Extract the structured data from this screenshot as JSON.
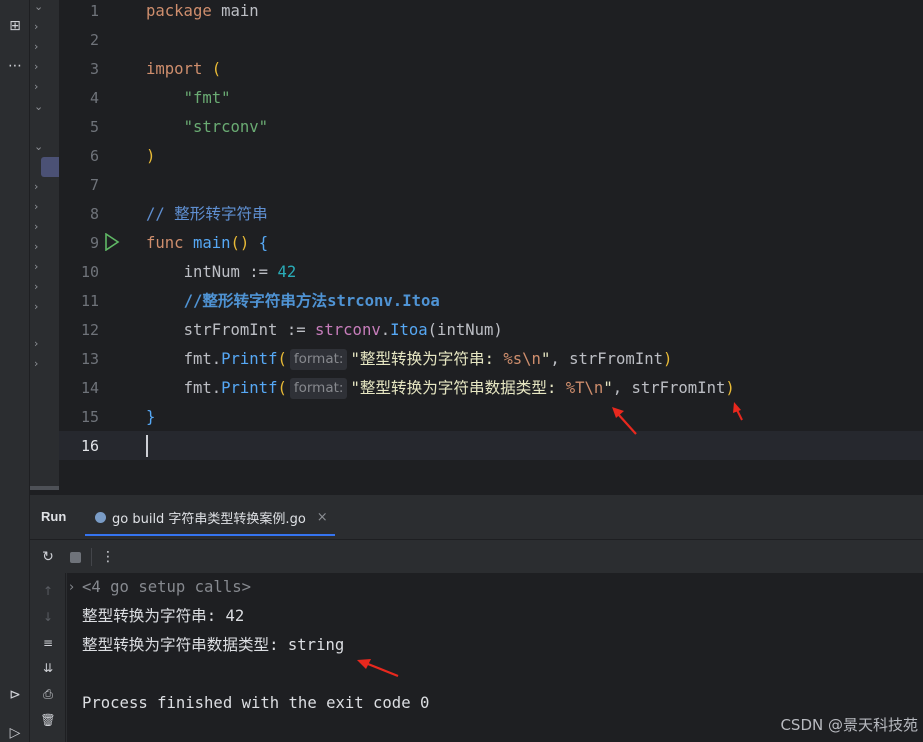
{
  "editor": {
    "line_numbers": [
      "1",
      "2",
      "3",
      "4",
      "5",
      "6",
      "7",
      "8",
      "9",
      "10",
      "11",
      "12",
      "13",
      "14",
      "15",
      "16"
    ],
    "current_line": "16",
    "code": {
      "l1_kw": "package",
      "l1_name": " main",
      "l3_kw": "import",
      "l3_paren": "(",
      "l4_str": "\"fmt\"",
      "l5_str": "\"strconv\"",
      "l6_paren": ")",
      "l8_cmt": "// 整形转字符串",
      "l9_kw": "func",
      "l9_fn": "main",
      "l9_parens": "()",
      "l9_brace": "{",
      "l10_ident": "intNum := ",
      "l10_num": "42",
      "l11_cmt": "//整形转字符串方法strconv.Itoa",
      "l12_ident": "strFromInt := ",
      "l12_pkg": "strconv",
      "l12_dot": ".",
      "l12_fn": "Itoa",
      "l12_args": "(intNum)",
      "l13_pkg": "fmt",
      "l13_dot": ".",
      "l13_fn": "Printf",
      "l13_open": "(",
      "l13_hint": "format:",
      "l13_str_a": "\"整型转换为字符串: ",
      "l13_esc": "%s\\n",
      "l13_str_b": "\"",
      "l13_rest": ", strFromInt",
      "l13_close": ")",
      "l14_pkg": "fmt",
      "l14_dot": ".",
      "l14_fn": "Printf",
      "l14_open": "(",
      "l14_hint": "format:",
      "l14_str_a": "\"整型转换为字符串数据类型: ",
      "l14_esc": "%T\\n",
      "l14_str_b": "\"",
      "l14_rest": ", strFromInt",
      "l14_close": ")",
      "l15_brace": "}"
    }
  },
  "run_panel": {
    "title": "Run",
    "tab_label": "go build 字符串类型转换案例.go",
    "tab_close": "×",
    "console_lines": {
      "setup": "<4 go setup calls>",
      "out1": "整型转换为字符串: 42",
      "out2": "整型转换为字符串数据类型: string",
      "exit": "Process finished with the exit code 0"
    }
  },
  "watermark": "CSDN @景天科技苑",
  "colors": {
    "keyword": "#cf8e6d",
    "string": "#6aab73",
    "comment": "#5f8fd1",
    "function": "#56a8f5",
    "number": "#2aacb8",
    "annotation_arrow": "#e8281e",
    "accent": "#3574f0"
  },
  "icons": {
    "toolstrip": [
      "structure-icon",
      "more-icon",
      "services-icon",
      "run-icon"
    ],
    "run_toolbar": [
      "rerun-icon",
      "stop-icon",
      "more-vertical-icon"
    ],
    "console_strip": [
      "up-icon",
      "down-icon",
      "soft-wrap-icon",
      "scroll-to-end-icon",
      "print-icon",
      "trash-icon"
    ]
  }
}
